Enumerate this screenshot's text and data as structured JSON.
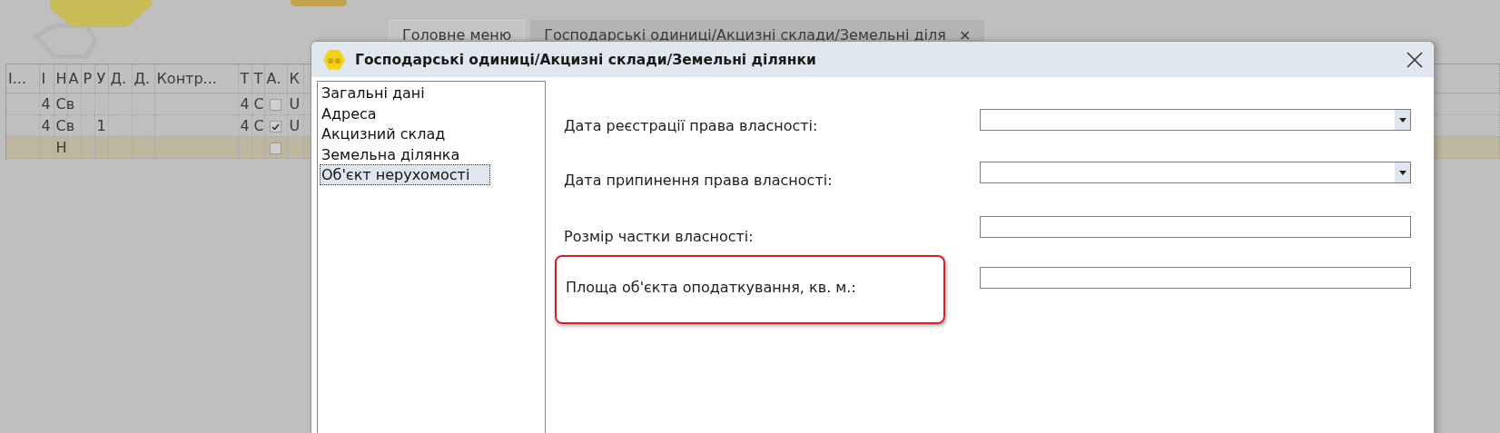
{
  "tabs": [
    {
      "label": "Головне меню",
      "selected": false
    },
    {
      "label": "Господарські одиниці/Акцизні склади/Земельні діля",
      "selected": true,
      "close": "×"
    }
  ],
  "grid": {
    "columns": [
      "І...",
      "І",
      "Н",
      "А",
      "Р",
      "У",
      "Д.",
      "Д.",
      "Контр...",
      "Т",
      "Т",
      "А.",
      "К"
    ],
    "rows": [
      {
        "selected": false,
        "cells": [
          "",
          "4",
          "Св",
          "",
          "",
          "",
          "",
          "",
          "",
          "4",
          "С",
          {
            "checked": false
          },
          "U"
        ]
      },
      {
        "selected": false,
        "cells": [
          "",
          "4",
          "Св",
          "",
          "",
          "1",
          "",
          "",
          "",
          "4",
          "С",
          {
            "checked": true
          },
          "U"
        ]
      },
      {
        "selected": true,
        "cells": [
          "",
          "",
          "Н",
          "",
          "",
          "",
          "",
          "",
          "",
          "",
          "",
          {
            "checked": false
          },
          ""
        ]
      }
    ]
  },
  "dialog": {
    "title": "Господарські одиниці/Акцизні склади/Земельні ділянки",
    "sections": [
      {
        "label": "Загальні дані",
        "selected": false
      },
      {
        "label": "Адреса",
        "selected": false
      },
      {
        "label": "Акцизний склад",
        "selected": false
      },
      {
        "label": "Земельна ділянка",
        "selected": false
      },
      {
        "label": "Об'єкт нерухомості",
        "selected": true
      }
    ],
    "fields": [
      {
        "label": "Дата реєстрації права власності:",
        "kind": "dropdown",
        "highlighted": false
      },
      {
        "label": "Дата припинення права власності:",
        "kind": "dropdown",
        "highlighted": false
      },
      {
        "label": "Розмір частки власності:",
        "kind": "text",
        "highlighted": false
      },
      {
        "label": "Площа об'єкта оподаткування, кв. м.:",
        "kind": "text",
        "highlighted": true
      }
    ]
  }
}
